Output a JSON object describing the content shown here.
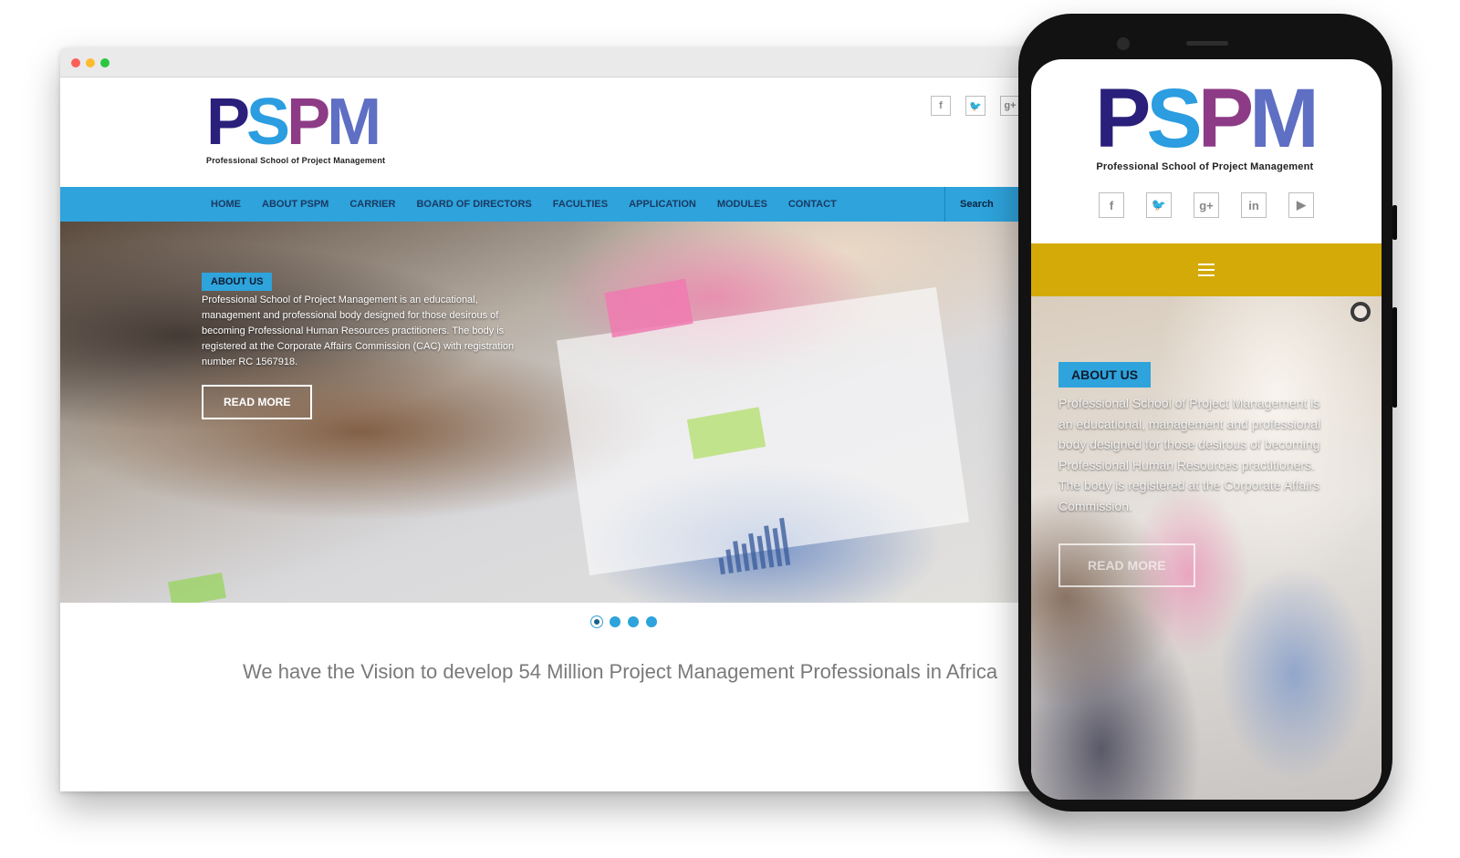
{
  "brand": {
    "logo_letters": [
      "P",
      "S",
      "P",
      "M"
    ],
    "logo_colors": [
      "#2a1f7a",
      "#2b9de0",
      "#8d3b86",
      "#5f6fc4"
    ],
    "tagline": "Professional School of Project Management"
  },
  "social": [
    {
      "icon": "facebook-icon",
      "glyph": "f"
    },
    {
      "icon": "twitter-icon",
      "glyph": "🐦"
    },
    {
      "icon": "google-plus-icon",
      "glyph": "g+"
    },
    {
      "icon": "linkedin-icon",
      "glyph": "in"
    }
  ],
  "mobile_social": [
    {
      "icon": "facebook-icon",
      "glyph": "f"
    },
    {
      "icon": "twitter-icon",
      "glyph": "🐦"
    },
    {
      "icon": "google-plus-icon",
      "glyph": "g+"
    },
    {
      "icon": "linkedin-icon",
      "glyph": "in"
    },
    {
      "icon": "youtube-icon",
      "glyph": "▶"
    }
  ],
  "nav": {
    "items": [
      "HOME",
      "ABOUT PSPM",
      "CARRIER",
      "BOARD OF DIRECTORS",
      "FACULTIES",
      "APPLICATION",
      "MODULES",
      "CONTACT"
    ],
    "search_placeholder": "Search"
  },
  "hero": {
    "badge": "ABOUT US",
    "text": "Professional School of Project Management is an educational, management and professional body designed for those desirous of becoming Professional Human Resources practitioners. The body is registered at the Corporate Affairs Commission (CAC) with registration number RC 1567918.",
    "button": "READ MORE"
  },
  "slider": {
    "count": 4,
    "active": 0
  },
  "vision": "We have the Vision to develop 54 Million Project Management Professionals in Africa",
  "mobile": {
    "badge": "ABOUT US",
    "text": "Professional School of Project Management is an educational, management and professional body designed for those desirous of becoming Professional Human Resources practitioners. The body is registered at the Corporate Affairs Commission.",
    "button": "READ MORE"
  },
  "colors": {
    "nav_bg": "#2ea3dc",
    "mobile_menu_bg": "#d4aa08",
    "vision_text": "#7a7a7a"
  }
}
